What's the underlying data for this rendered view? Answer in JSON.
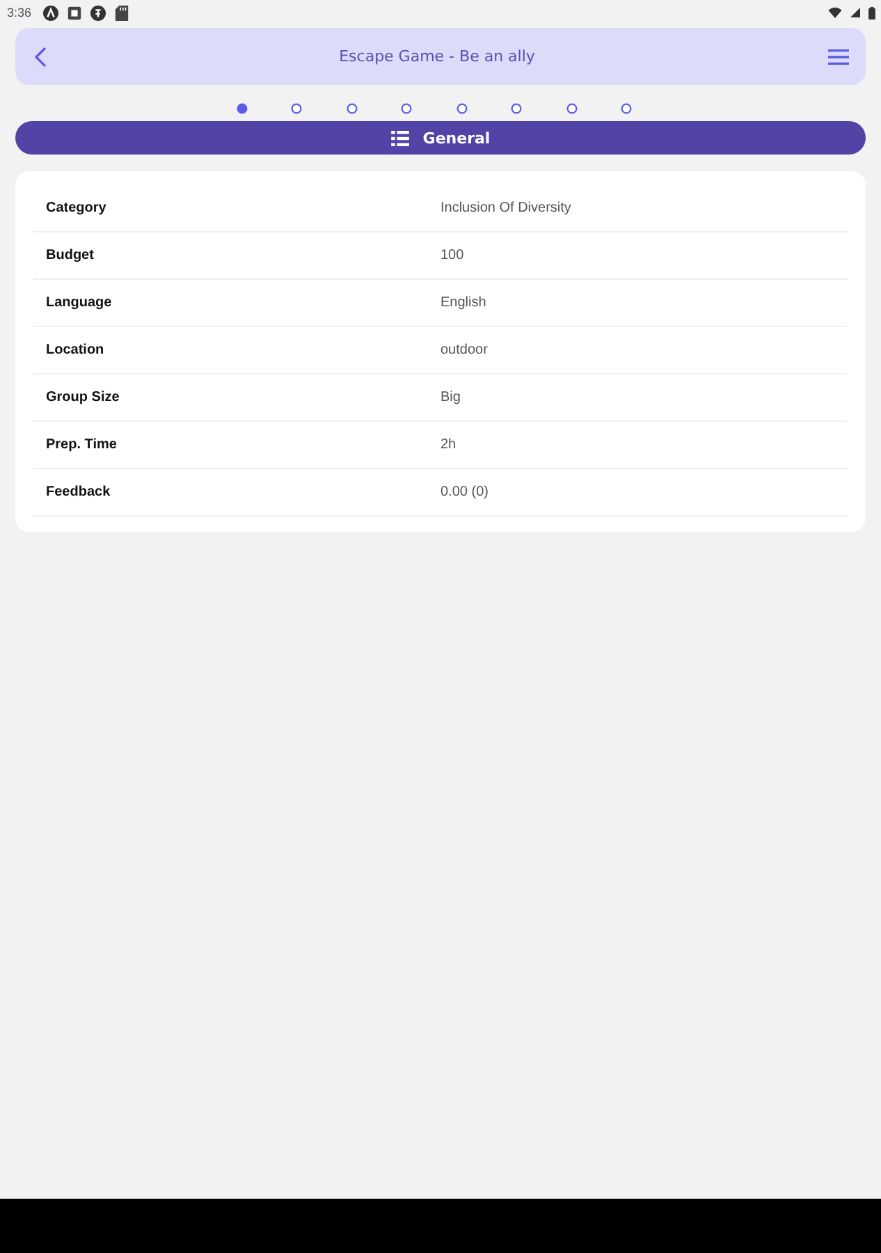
{
  "status_bar": {
    "time": "3:36"
  },
  "header": {
    "title": "Escape Game - Be an ally"
  },
  "pager": [
    {
      "selected": true
    },
    {
      "selected": false
    },
    {
      "selected": false
    },
    {
      "selected": false
    },
    {
      "selected": false
    },
    {
      "selected": false
    },
    {
      "selected": false
    },
    {
      "selected": false
    }
  ],
  "section": {
    "title": "General"
  },
  "details": [
    {
      "label": "Category",
      "value": "Inclusion Of Diversity"
    },
    {
      "label": "Budget",
      "value": "100"
    },
    {
      "label": "Language",
      "value": "English"
    },
    {
      "label": "Location",
      "value": "outdoor"
    },
    {
      "label": "Group Size",
      "value": "Big"
    },
    {
      "label": "Prep. Time",
      "value": "2h"
    },
    {
      "label": "Feedback",
      "value": "0.00 (0)"
    }
  ]
}
